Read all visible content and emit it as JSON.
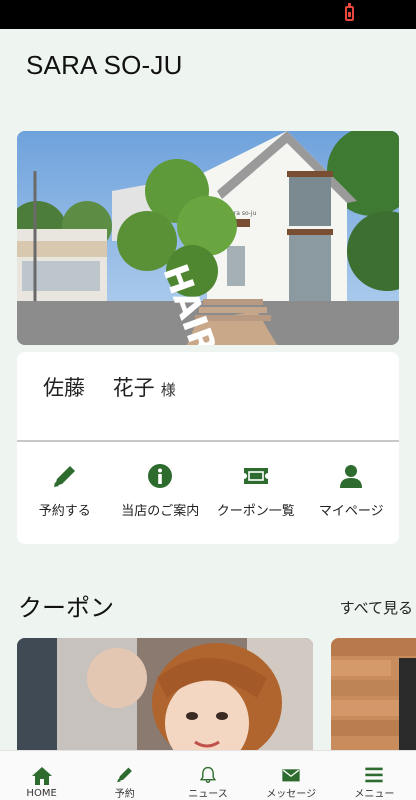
{
  "app": {
    "title": "SARA SO-JU"
  },
  "colors": {
    "accent": "#2e6b2e",
    "background": "#eef4f0",
    "battery": "#e8473b"
  },
  "hero": {
    "sign_text": "HAIR",
    "building_text": "sara so-ju"
  },
  "user": {
    "name": "佐藤　 花子",
    "suffix": "様"
  },
  "actions": [
    {
      "label": "予約する",
      "icon": "pencil-icon"
    },
    {
      "label": "当店のご案内",
      "icon": "info-icon"
    },
    {
      "label": "クーポン一覧",
      "icon": "ticket-icon"
    },
    {
      "label": "マイページ",
      "icon": "person-icon"
    }
  ],
  "coupons": {
    "title": "クーポン",
    "see_all": "すべて見る"
  },
  "nav": [
    {
      "label": "HOME",
      "icon": "home-icon"
    },
    {
      "label": "予約",
      "icon": "pencil-icon"
    },
    {
      "label": "ニュース",
      "icon": "bell-icon"
    },
    {
      "label": "メッセージ",
      "icon": "mail-icon"
    },
    {
      "label": "メニュー",
      "icon": "menu-icon"
    }
  ]
}
